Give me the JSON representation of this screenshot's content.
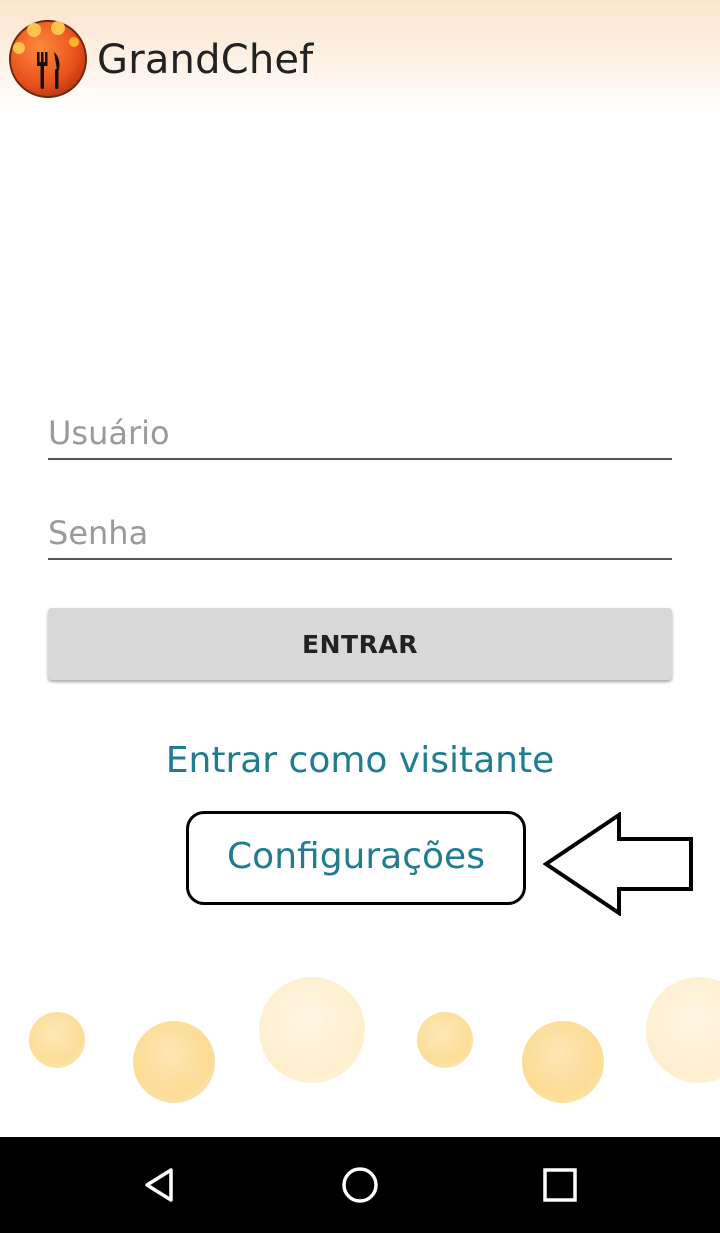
{
  "app": {
    "title": "GrandChef",
    "logo_icon": "restaurant-fork-knife-icon"
  },
  "login": {
    "username_placeholder": "Usuário",
    "username_value": "",
    "password_placeholder": "Senha",
    "password_value": "",
    "enter_label": "ENTRAR",
    "guest_label": "Entrar como visitante",
    "settings_label": "Configurações"
  },
  "annotation": {
    "arrow_icon": "left-arrow-outline-icon",
    "highlight": "settings-box"
  },
  "navbar": {
    "back_icon": "triangle-back-icon",
    "home_icon": "circle-home-icon",
    "recents_icon": "square-recents-icon"
  },
  "colors": {
    "accent": "#1f7d8f",
    "logo": "#e8501c",
    "button_bg": "#d8d8d8",
    "navbar_bg": "#000000"
  }
}
